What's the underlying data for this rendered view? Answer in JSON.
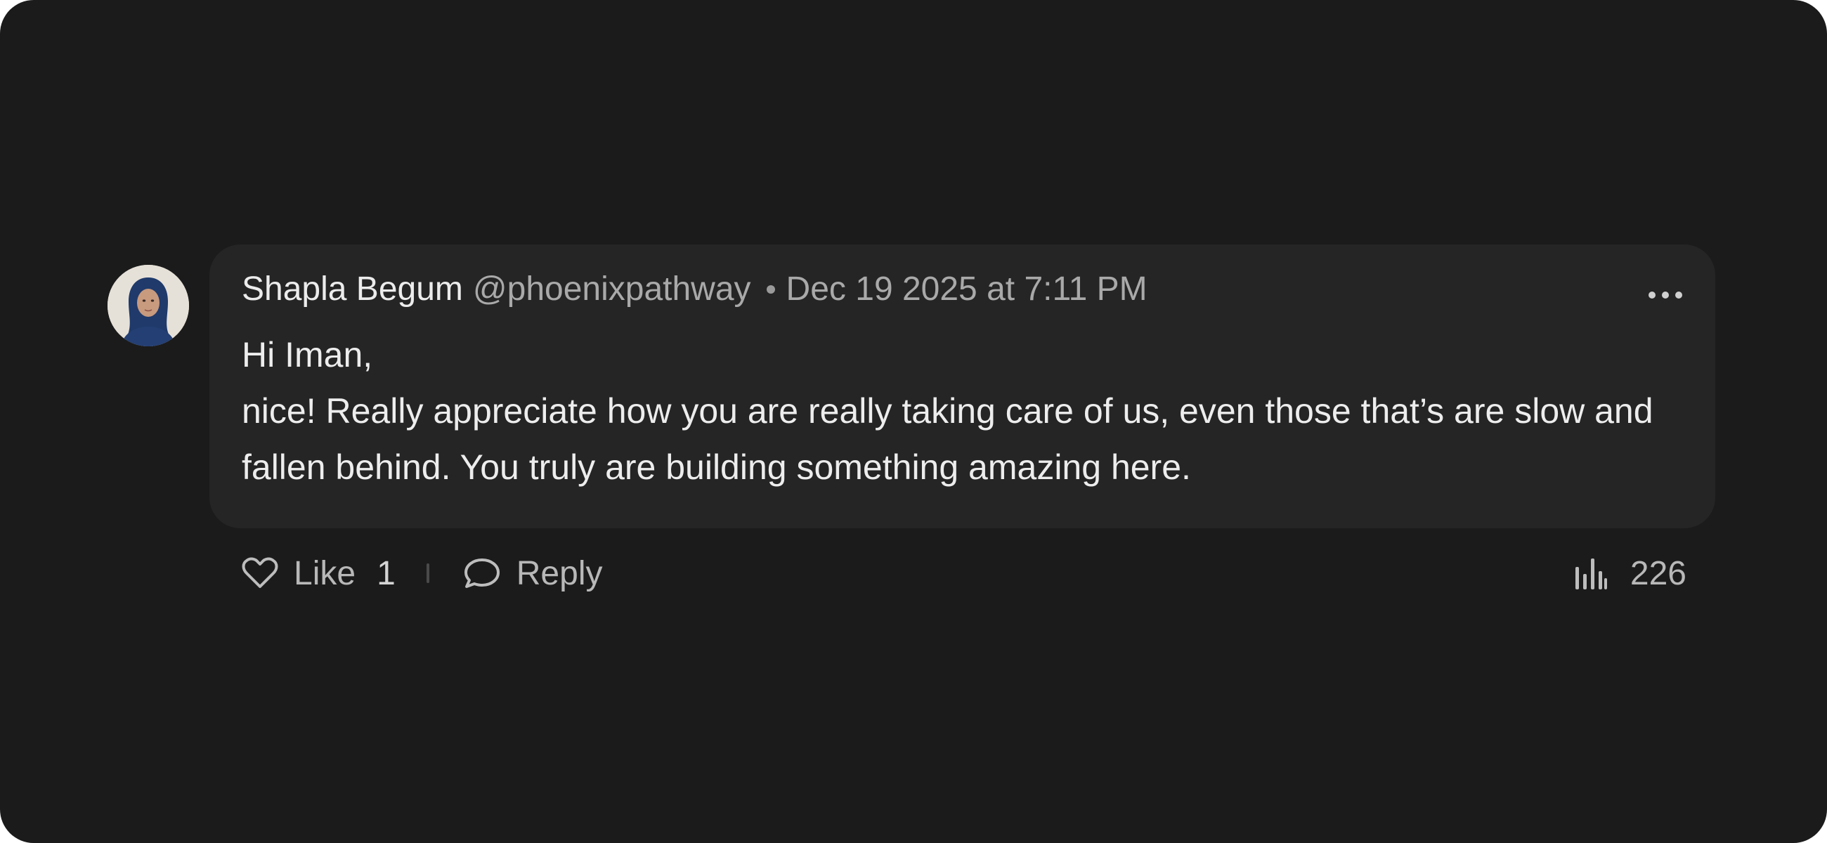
{
  "comment": {
    "author_name": "Shapla Begum",
    "author_handle": "@phoenixpathway",
    "timestamp": "Dec 19 2025 at 7:11 PM",
    "body_lines": [
      "Hi Iman,",
      "nice! Really appreciate how you are really taking care of us, even those that’s are slow and fallen behind. You truly are building something amazing here."
    ],
    "more_icon": "more-horizontal-icon",
    "avatar_icon": "user-avatar"
  },
  "actions": {
    "like_label": "Like",
    "like_count": "1",
    "like_icon": "heart-icon",
    "reply_label": "Reply",
    "reply_icon": "chat-bubble-icon",
    "views_count": "226",
    "views_icon": "bar-chart-icon"
  },
  "colors": {
    "page_background": "#1b1b1b",
    "bubble_background": "#252525",
    "primary_text": "#ececec",
    "secondary_text": "#a9a9a9"
  }
}
